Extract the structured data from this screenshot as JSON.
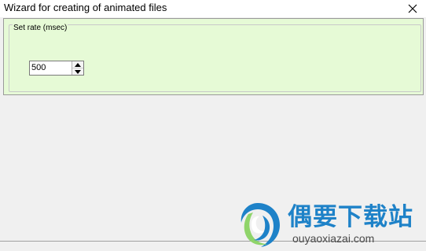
{
  "window": {
    "title": "Wizard for creating of animated files",
    "close_icon": "close-icon"
  },
  "rate_group": {
    "legend": "Set rate (msec)",
    "rate_value": "500",
    "spin_up_icon": "triangle-up-icon",
    "spin_down_icon": "triangle-down-icon"
  },
  "watermark": {
    "title": "偶要下载站",
    "url": "ouyaoxiazai.com",
    "logo_icon": "swirl-logo-icon",
    "colors": {
      "brand_blue": "#1e82c8",
      "brand_green": "#5cb85c"
    }
  },
  "colors": {
    "panel_bg": "#e6fad6",
    "window_bg": "#f0f0f0",
    "titlebar_bg": "#ffffff"
  }
}
